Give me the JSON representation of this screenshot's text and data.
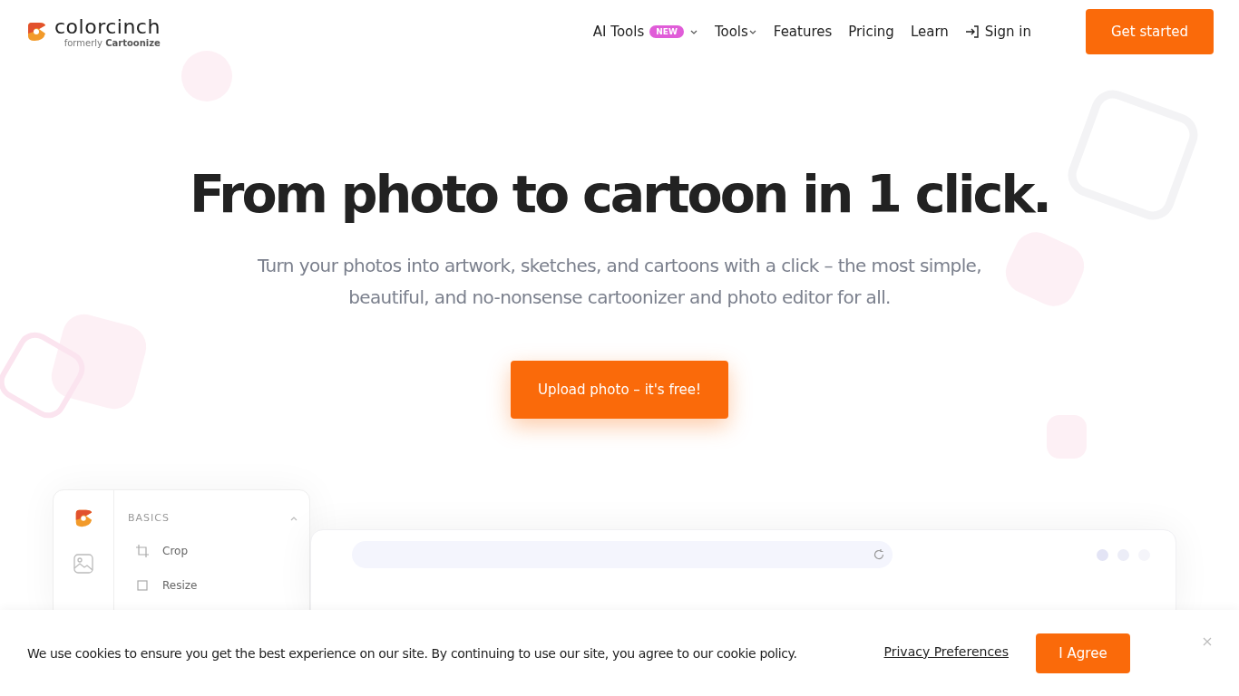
{
  "header": {
    "logo": {
      "name": "colorcinch",
      "tagline_prefix": "formerly",
      "tagline_brand": "Cartoonize"
    },
    "nav": [
      {
        "label": "AI Tools",
        "kind": "link",
        "badge": "NEW",
        "dropdown": true
      },
      {
        "label": "Tools",
        "kind": "link",
        "dropdown": true
      },
      {
        "label": "Features",
        "kind": "link",
        "dropdown": false
      },
      {
        "label": "Pricing",
        "kind": "link",
        "dropdown": false
      },
      {
        "label": "Learn",
        "kind": "link",
        "dropdown": false
      },
      {
        "label": "Sign in",
        "kind": "signin",
        "dropdown": false
      }
    ],
    "cta": "Get started"
  },
  "hero": {
    "title": "From photo to cartoon in 1 click.",
    "subtitle": "Turn your photos into artwork, sketches, and cartoons with a click – the most simple, beautiful, and no-nonsense cartoonizer and photo editor for all.",
    "button": "Upload photo – it's free!"
  },
  "editor_preview": {
    "section": {
      "title": "BASICS",
      "expanded": true,
      "items": [
        {
          "label": "Crop",
          "kind": "crop"
        },
        {
          "label": "Resize",
          "kind": "resize"
        }
      ]
    }
  },
  "cookie_banner": {
    "text": "We use cookies to ensure you get the best experience on our site. By continuing to use our site, you agree to our cookie policy.",
    "link": "Privacy Preferences",
    "button": "I Agree"
  }
}
